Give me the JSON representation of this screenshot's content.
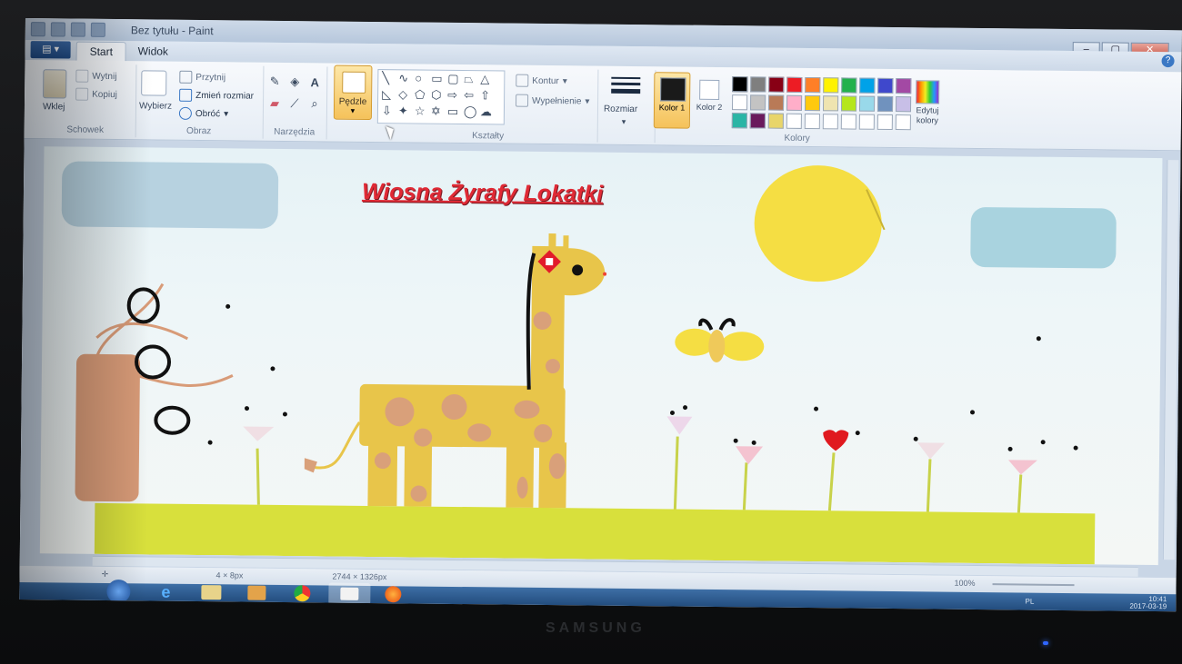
{
  "window": {
    "title": "Bez tytułu - Paint"
  },
  "menu": {
    "tabs": [
      {
        "label": "Start"
      },
      {
        "label": "Widok"
      }
    ]
  },
  "ribbon": {
    "schowek": {
      "paste": "Wklej",
      "cut": "Wytnij",
      "copy": "Kopiuj",
      "label": "Schowek"
    },
    "obraz": {
      "select": "Wybierz",
      "crop": "Przytnij",
      "resize": "Zmień rozmiar",
      "rotate": "Obróć",
      "label": "Obraz"
    },
    "narzedzia": {
      "label": "Narzędzia",
      "text_tool": "A"
    },
    "pedzle": {
      "label": "Pędzle"
    },
    "ksztalty": {
      "outline": "Kontur",
      "fill": "Wypełnienie",
      "label": "Kształty"
    },
    "rozmiar": {
      "label": "Rozmiar"
    },
    "kolory": {
      "color1": "Kolor 1",
      "color2": "Kolor 2",
      "edit": "Edytuj kolory",
      "label": "Kolory",
      "color1_value": "#1a1a1a",
      "color2_value": "#ffffff",
      "palette": [
        "#000000",
        "#7f7f7f",
        "#880015",
        "#ed1c24",
        "#ff7f27",
        "#fff200",
        "#22b14c",
        "#00a2e8",
        "#3f48cc",
        "#a349a4",
        "#ffffff",
        "#c3c3c3",
        "#b97a57",
        "#ffaec9",
        "#ffc90e",
        "#efe4b0",
        "#b5e61d",
        "#99d9ea",
        "#7092be",
        "#c8bfe7",
        "#2ab5a5",
        "#6a1a5c",
        "#e8d56a",
        "#ffffff",
        "#ffffff",
        "#ffffff",
        "#ffffff",
        "#ffffff",
        "#ffffff",
        "#ffffff"
      ]
    }
  },
  "canvas": {
    "heading": "Wiosna Żyrafy Lokatki"
  },
  "status": {
    "cursor_pos": "4 × 8px",
    "image_size": "2744 × 1326px",
    "zoom": "100%"
  },
  "taskbar": {
    "language": "PL",
    "time": "10:41",
    "date": "2017-03-19"
  },
  "monitor": {
    "brand": "SAMSUNG"
  }
}
